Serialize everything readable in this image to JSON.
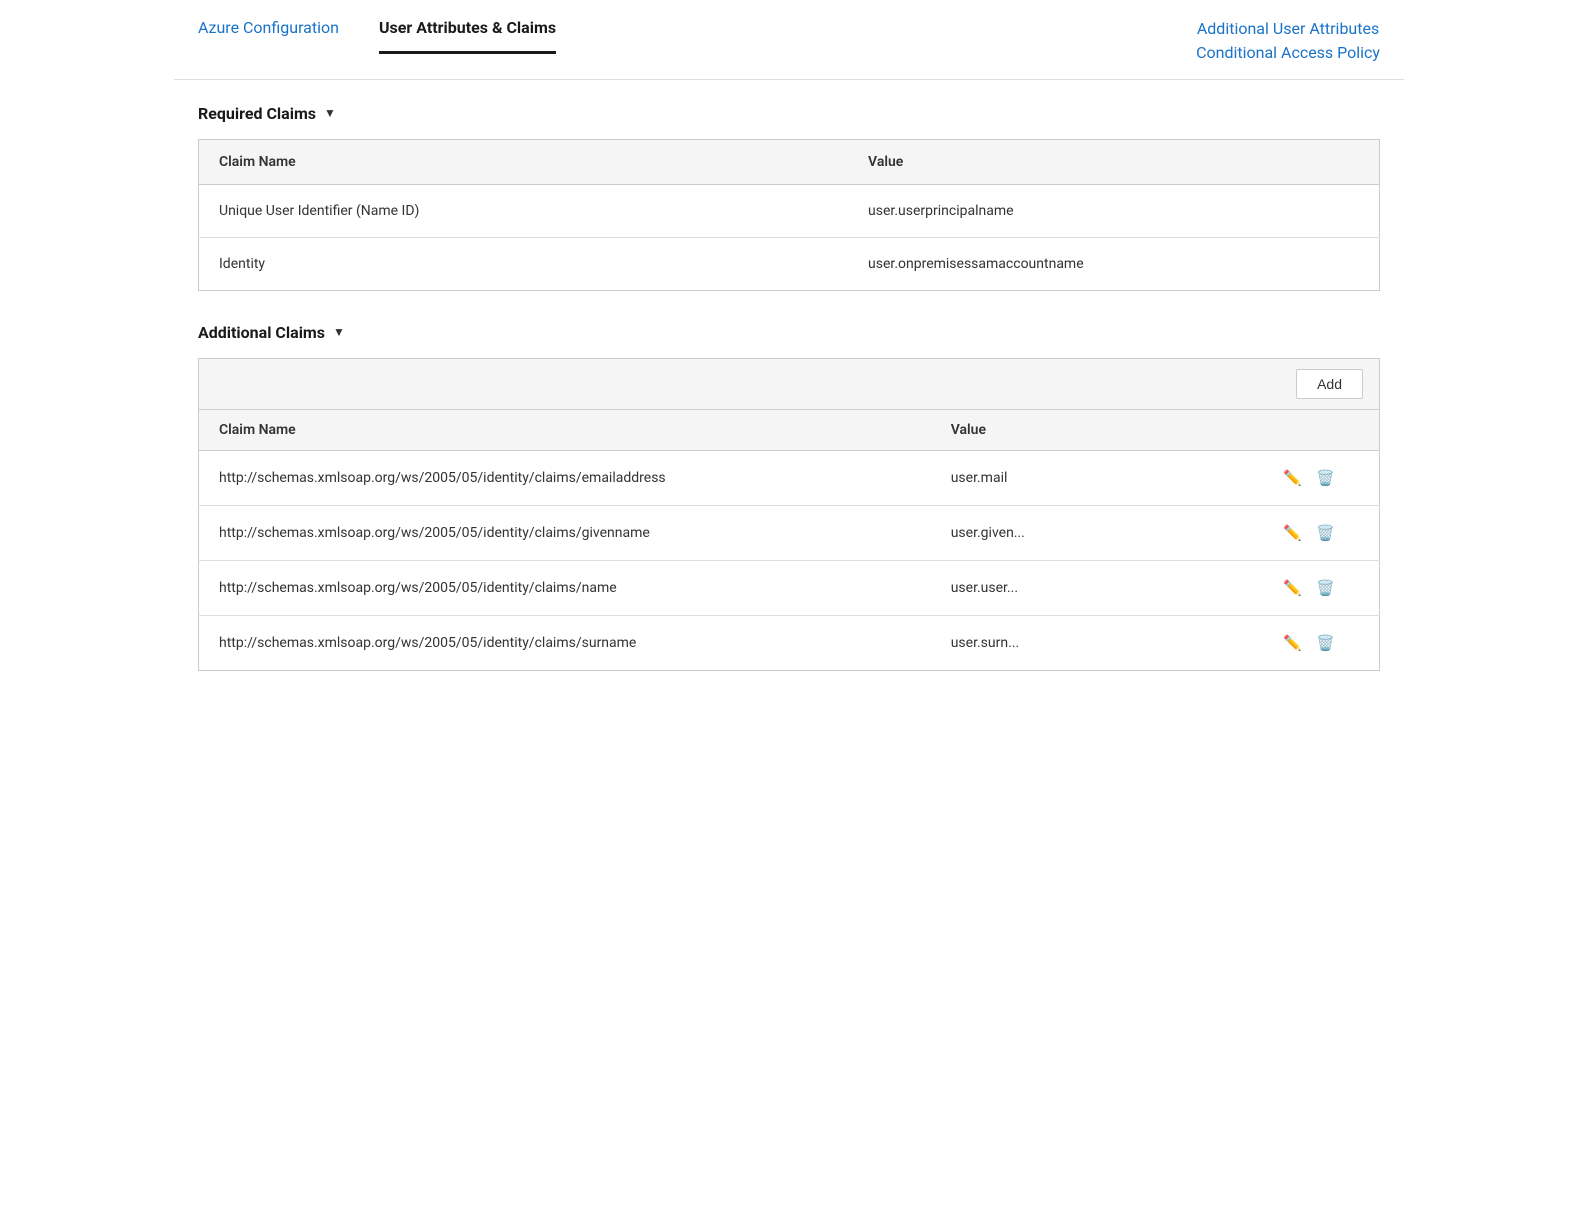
{
  "nav": {
    "tabs": [
      {
        "id": "azure-config",
        "label": "Azure Configuration",
        "active": false
      },
      {
        "id": "user-attributes",
        "label": "User Attributes & Claims",
        "active": true
      }
    ],
    "right_group": {
      "line1": "Additional User Attributes",
      "line2": "Conditional Access Policy"
    }
  },
  "required_claims": {
    "section_label": "Required Claims",
    "arrow": "▼",
    "table": {
      "col_name": "Claim Name",
      "col_value": "Value",
      "rows": [
        {
          "name": "Unique User Identifier (Name ID)",
          "value": "user.userprincipalname"
        },
        {
          "name": "Identity",
          "value": "user.onpremisessamaccountname"
        }
      ]
    }
  },
  "additional_claims": {
    "section_label": "Additional Claims",
    "arrow": "▼",
    "add_button": "Add",
    "table": {
      "col_name": "Claim Name",
      "col_value": "Value",
      "rows": [
        {
          "name": "http://schemas.xmlsoap.org/ws/2005/05/identity/claims/emailaddress",
          "value": "user.mail"
        },
        {
          "name": "http://schemas.xmlsoap.org/ws/2005/05/identity/claims/givenname",
          "value": "user.given..."
        },
        {
          "name": "http://schemas.xmlsoap.org/ws/2005/05/identity/claims/name",
          "value": "user.user..."
        },
        {
          "name": "http://schemas.xmlsoap.org/ws/2005/05/identity/claims/surname",
          "value": "user.surn..."
        }
      ]
    }
  },
  "icons": {
    "pencil": "✏",
    "trash": "🗑"
  }
}
